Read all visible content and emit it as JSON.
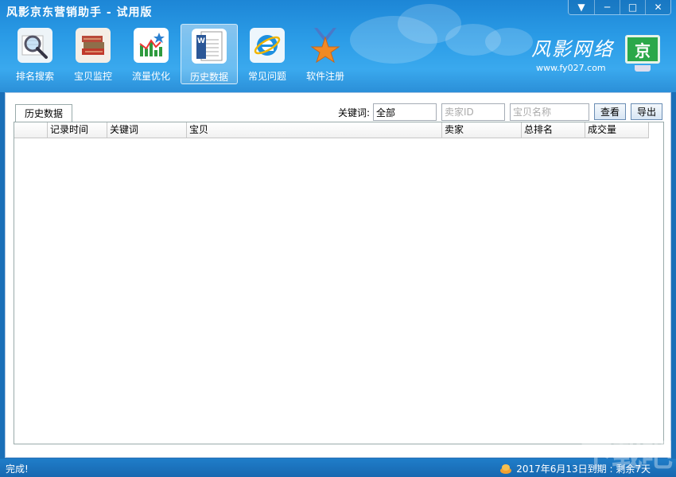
{
  "app": {
    "title": "风影京东营销助手 - 试用版"
  },
  "window_controls": {
    "menu": "▼",
    "minimize": "─",
    "maximize": "□",
    "close": "✕"
  },
  "toolbar": {
    "items": [
      {
        "label": "排名搜索",
        "icon": "magnifier-icon"
      },
      {
        "label": "宝贝监控",
        "icon": "books-icon"
      },
      {
        "label": "流量优化",
        "icon": "bar-chart-icon"
      },
      {
        "label": "历史数据",
        "icon": "word-document-icon",
        "active": true
      },
      {
        "label": "常见问题",
        "icon": "ie-browser-icon"
      },
      {
        "label": "软件注册",
        "icon": "medal-icon"
      }
    ]
  },
  "brand": {
    "name": "风影网络",
    "url": "www.fy027.com",
    "monitor_text": "京"
  },
  "content": {
    "tab_label": "历史数据",
    "keyword_label": "关键词:",
    "keyword_value": "全部",
    "seller_id_placeholder": "卖家ID",
    "item_name_placeholder": "宝贝名称",
    "view_button": "查看",
    "export_button": "导出",
    "columns": [
      "",
      "记录时间",
      "关键词",
      "宝贝",
      "卖家",
      "总排名",
      "成交量"
    ],
    "rows": []
  },
  "status": {
    "left": "完成!",
    "right": "2017年6月13日到期 : 剩余7天"
  },
  "watermark": "下载吧",
  "colors": {
    "header_blue": "#2a9be6",
    "status_blue": "#1a6fb8",
    "medal_orange": "#f08a24"
  }
}
